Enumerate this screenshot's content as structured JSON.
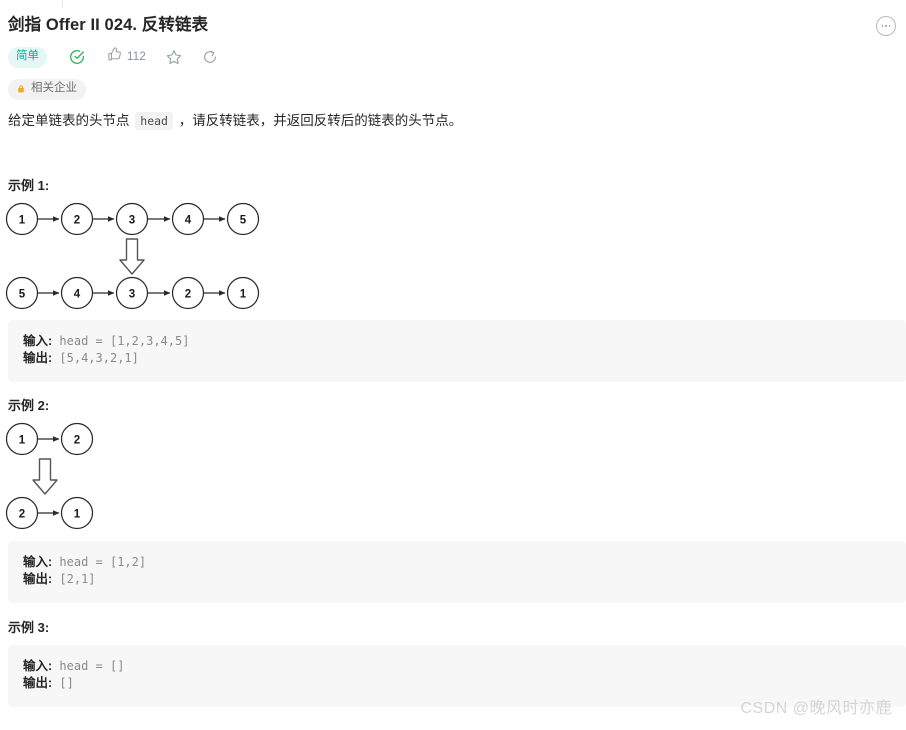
{
  "header": {
    "title": "剑指 Offer II 024. 反转链表",
    "more_icon": "more-options-icon"
  },
  "meta": {
    "difficulty": "简单",
    "difficulty_color": "#00af9b",
    "difficulty_bg": "#e5f7f4",
    "solved_icon": "check-circle-icon",
    "solved_color": "#2db55d",
    "like_icon": "thumbs-up-icon",
    "like_count": "112",
    "favorite_icon": "star-icon",
    "share_icon": "share-icon"
  },
  "company": {
    "lock_icon": "lock-icon",
    "lock_color": "#eeaa22",
    "label": "相关企业"
  },
  "description": {
    "before_code": "给定单链表的头节点 ",
    "code": "head",
    "after_code": " ，请反转链表，并返回反转后的链表的头节点。"
  },
  "examples": [
    {
      "heading": "示例 1:",
      "diagram": {
        "top_nodes": [
          "1",
          "2",
          "3",
          "4",
          "5"
        ],
        "bottom_nodes": [
          "5",
          "4",
          "3",
          "2",
          "1"
        ],
        "transform_arrow": "block-arrow-down"
      },
      "input_label": "输入:",
      "input_value": " head = [1,2,3,4,5]",
      "output_label": "输出:",
      "output_value": " [5,4,3,2,1]"
    },
    {
      "heading": "示例 2:",
      "diagram": {
        "top_nodes": [
          "1",
          "2"
        ],
        "bottom_nodes": [
          "2",
          "1"
        ],
        "transform_arrow": "block-arrow-down"
      },
      "input_label": "输入:",
      "input_value": " head = [1,2]",
      "output_label": "输出:",
      "output_value": " [2,1]"
    },
    {
      "heading": "示例 3:",
      "diagram": null,
      "input_label": "输入:",
      "input_value": " head = []",
      "output_label": "输出:",
      "output_value": " []"
    }
  ],
  "watermark": "CSDN @晚风时亦鹿"
}
